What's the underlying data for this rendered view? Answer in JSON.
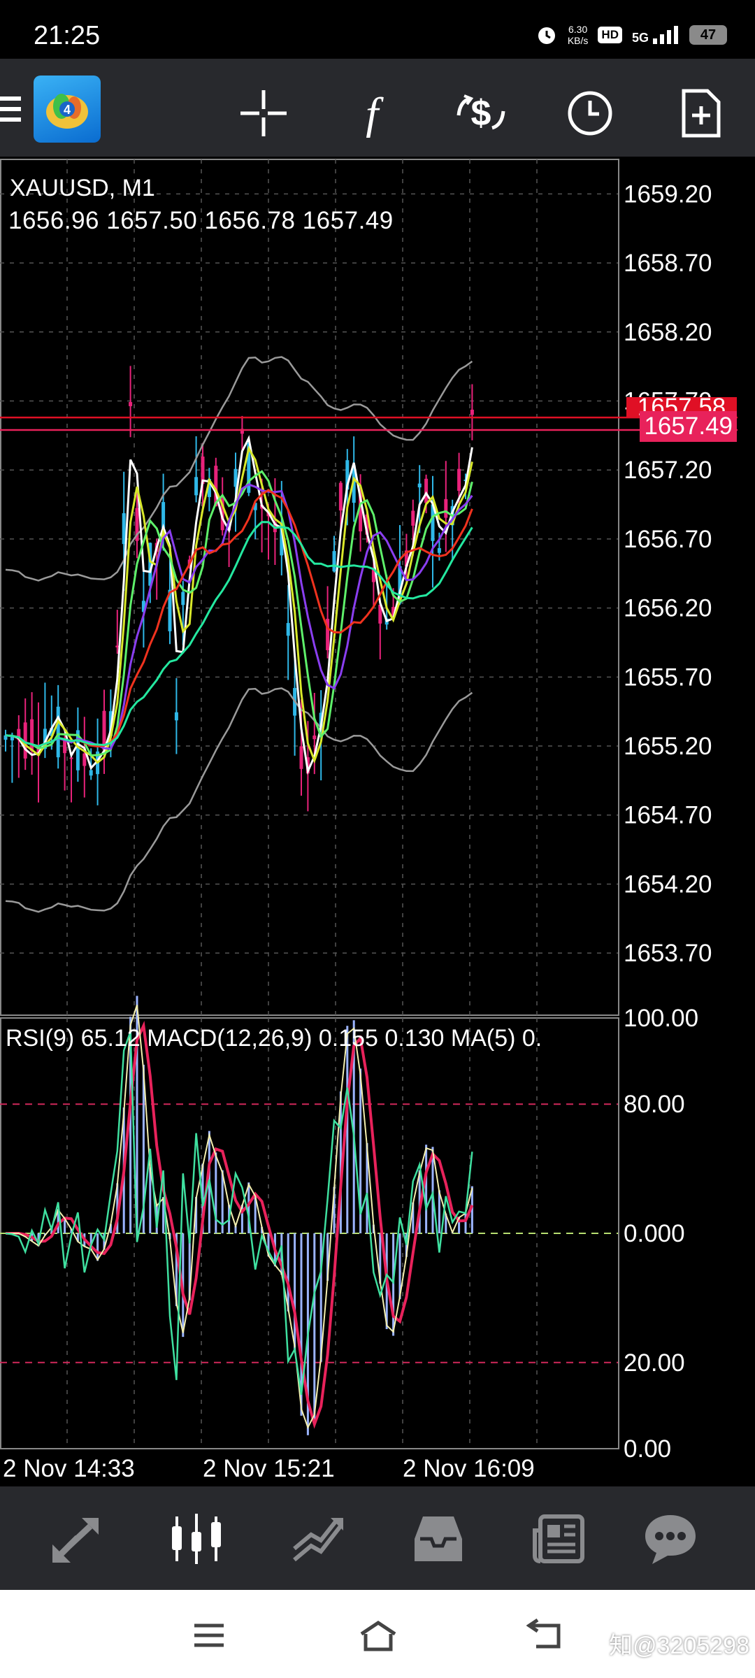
{
  "status_bar": {
    "time": "21:25",
    "net_speed_value": "6.30",
    "net_speed_unit": "KB/s",
    "hd_label": "HD",
    "signal_label": "5G",
    "battery": "47"
  },
  "toolbar": {
    "app_icon": "metatrader-logo-icon",
    "icons": [
      "menu-icon",
      "crosshair-icon",
      "indicators-f-icon",
      "trade-dollar-icon",
      "timeframe-clock-icon",
      "new-document-icon"
    ]
  },
  "chart": {
    "symbol": "XAUUSD, M1",
    "ohlc": "1656.96 1657.50 1656.78 1657.49",
    "current_bid": "1657.49",
    "current_ask": "1657.58",
    "price_axis": [
      "1659.20",
      "1658.70",
      "1658.20",
      "1657.70",
      "1657.20",
      "1656.70",
      "1656.20",
      "1655.70",
      "1655.20",
      "1654.70",
      "1654.20",
      "1653.70"
    ],
    "indicator_label": "RSI(9) 65.12 MACD(12,26,9) 0.155 0.130 MA(5) 0.",
    "indicator_axis": [
      "100.00",
      "80.00",
      "0.000",
      "20.00",
      "0.00"
    ],
    "time_axis": [
      "2 Nov 14:33",
      "2 Nov 15:21",
      "2 Nov 16:09"
    ],
    "colors": {
      "bull_candle": "#2fb8e8",
      "bear_candle": "#e8227a",
      "bid_line": "#e8225b",
      "ask_line": "#e01025",
      "bollinger": "#9a9a9a",
      "ma_fast": "#ffffff",
      "ma_yellow": "#d8e82a",
      "ma_green": "#5ef06a",
      "ma_purple": "#8a3ef0",
      "ma_red": "#f0321e",
      "ma_teal": "#24e8a0",
      "rsi_line": "#3fe0a0",
      "macd_hist": "#9bb4ff",
      "level_line": "#d0285a",
      "zero_line": "#b8e070"
    }
  },
  "bottom_nav": {
    "items": [
      "quotes-arrows-icon",
      "chart-candles-icon",
      "trade-icon",
      "history-inbox-icon",
      "news-icon",
      "chat-icon"
    ],
    "active": "chart-candles-icon"
  },
  "system_nav": {
    "items": [
      "recent-apps-icon",
      "home-icon",
      "back-icon"
    ],
    "watermark": "知@3205298"
  }
}
